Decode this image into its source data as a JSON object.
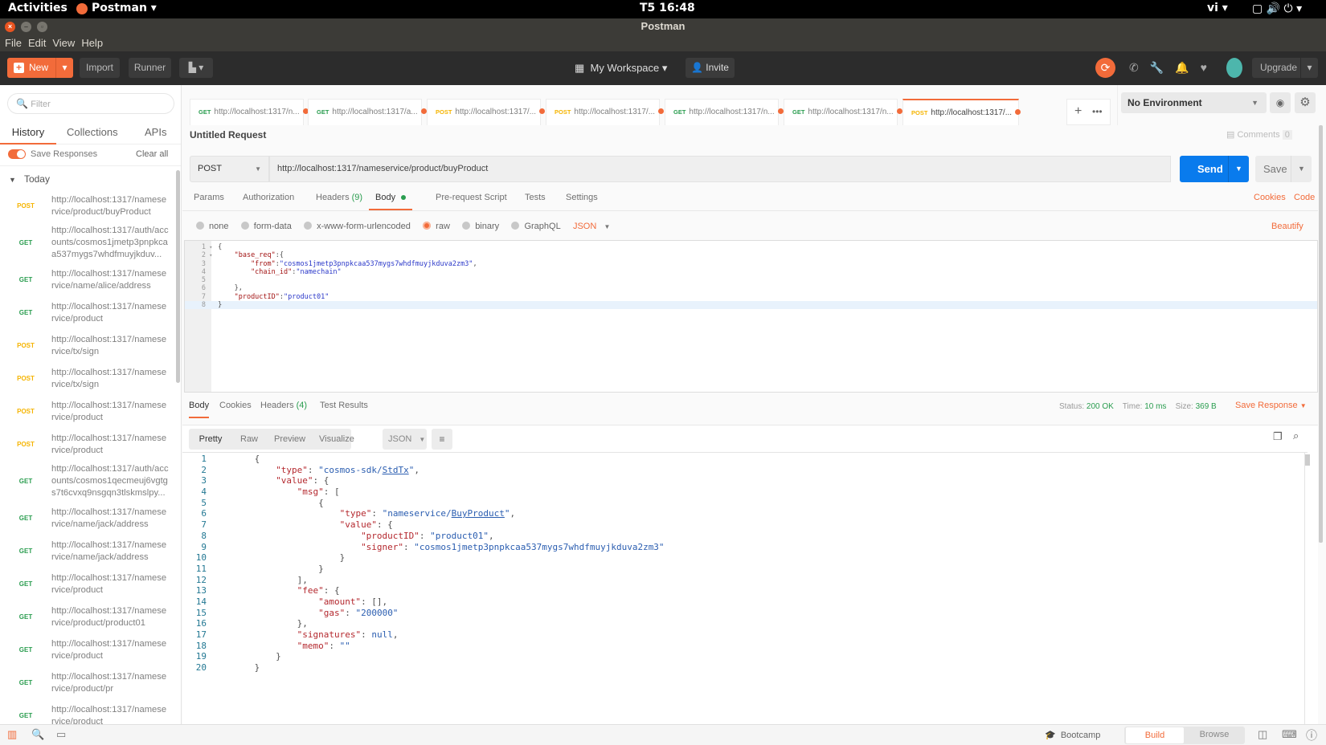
{
  "system": {
    "activities": "Activities",
    "app": "Postman",
    "clock": "T5 16:48",
    "lang": "vi"
  },
  "window": {
    "title": "Postman"
  },
  "menu": [
    "File",
    "Edit",
    "View",
    "Help"
  ],
  "toolbar": {
    "new": "New",
    "import": "Import",
    "runner": "Runner",
    "workspace": "My Workspace",
    "invite": "Invite",
    "upgrade": "Upgrade"
  },
  "sidebar": {
    "filter_placeholder": "Filter",
    "tabs": [
      "History",
      "Collections",
      "APIs"
    ],
    "save_responses": "Save Responses",
    "clear_all": "Clear all",
    "group": "Today",
    "items": [
      {
        "method": "POST",
        "url": "http://localhost:1317/nameservice/product/buyProduct"
      },
      {
        "method": "GET",
        "url": "http://localhost:1317/auth/accounts/cosmos1jmetp3pnpkcaa537mygs7whdfmuyjkduv..."
      },
      {
        "method": "GET",
        "url": "http://localhost:1317/nameservice/name/alice/address"
      },
      {
        "method": "GET",
        "url": "http://localhost:1317/nameservice/product"
      },
      {
        "method": "POST",
        "url": "http://localhost:1317/nameservice/tx/sign"
      },
      {
        "method": "POST",
        "url": "http://localhost:1317/nameservice/tx/sign"
      },
      {
        "method": "POST",
        "url": "http://localhost:1317/nameservice/product"
      },
      {
        "method": "POST",
        "url": "http://localhost:1317/nameservice/product"
      },
      {
        "method": "GET",
        "url": "http://localhost:1317/auth/accounts/cosmos1qecmeuj6vgtgs7t6cvxq9nsgqn3tlskmslpy..."
      },
      {
        "method": "GET",
        "url": "http://localhost:1317/nameservice/name/jack/address"
      },
      {
        "method": "GET",
        "url": "http://localhost:1317/nameservice/name/jack/address"
      },
      {
        "method": "GET",
        "url": "http://localhost:1317/nameservice/product"
      },
      {
        "method": "GET",
        "url": "http://localhost:1317/nameservice/product/product01"
      },
      {
        "method": "GET",
        "url": "http://localhost:1317/nameservice/product"
      },
      {
        "method": "GET",
        "url": "http://localhost:1317/nameservice/product/pr"
      },
      {
        "method": "GET",
        "url": "http://localhost:1317/nameservice/product"
      }
    ]
  },
  "tabs": [
    {
      "method": "GET",
      "url": "http://localhost:1317/n..."
    },
    {
      "method": "GET",
      "url": "http://localhost:1317/a..."
    },
    {
      "method": "POST",
      "url": "http://localhost:1317/..."
    },
    {
      "method": "POST",
      "url": "http://localhost:1317/..."
    },
    {
      "method": "GET",
      "url": "http://localhost:1317/n..."
    },
    {
      "method": "GET",
      "url": "http://localhost:1317/n..."
    },
    {
      "method": "POST",
      "url": "http://localhost:1317/..."
    }
  ],
  "environment": "No Environment",
  "request": {
    "name": "Untitled Request",
    "comments": "Comments",
    "comments_count": "0",
    "method": "POST",
    "url": "http://localhost:1317/nameservice/product/buyProduct",
    "send": "Send",
    "save": "Save",
    "tabs": {
      "params": "Params",
      "authorization": "Authorization",
      "headers": "Headers",
      "headers_count": "(9)",
      "body": "Body",
      "prerequest": "Pre-request Script",
      "tests": "Tests",
      "settings": "Settings"
    },
    "cookies": "Cookies",
    "code": "Code",
    "body_types": [
      "none",
      "form-data",
      "x-www-form-urlencoded",
      "raw",
      "binary",
      "GraphQL"
    ],
    "format": "JSON",
    "beautify": "Beautify",
    "body_lines": [
      "{",
      "    \"base_req\":{",
      "        \"from\":\"cosmos1jmetp3pnpkcaa537mygs7whdfmuyjkduva2zm3\",",
      "        \"chain_id\":\"namechain\"",
      "",
      "    },",
      "    \"productID\":\"product01\"",
      "}"
    ]
  },
  "response": {
    "tabs": {
      "body": "Body",
      "cookies": "Cookies",
      "headers": "Headers",
      "headers_count": "(4)",
      "tests": "Test Results"
    },
    "status_label": "Status:",
    "status": "200 OK",
    "time_label": "Time:",
    "time": "10 ms",
    "size_label": "Size:",
    "size": "369 B",
    "save": "Save Response",
    "views": [
      "Pretty",
      "Raw",
      "Preview",
      "Visualize"
    ],
    "format": "JSON",
    "lines": [
      "{",
      "    \"type\": \"cosmos-sdk/StdTx\",",
      "    \"value\": {",
      "        \"msg\": [",
      "            {",
      "                \"type\": \"nameservice/BuyProduct\",",
      "                \"value\": {",
      "                    \"productID\": \"product01\",",
      "                    \"signer\": \"cosmos1jmetp3pnpkcaa537mygs7whdfmuyjkduva2zm3\"",
      "                }",
      "            }",
      "        ],",
      "        \"fee\": {",
      "            \"amount\": [],",
      "            \"gas\": \"200000\"",
      "        },",
      "        \"signatures\": null,",
      "        \"memo\": \"\"",
      "    }",
      "}"
    ]
  },
  "statusbar": {
    "bootcamp": "Bootcamp",
    "build": "Build",
    "browse": "Browse"
  },
  "colors": {
    "accent": "#f26b3a",
    "send": "#097bed",
    "get": "#2a9d4f",
    "post": "#f5b400"
  }
}
